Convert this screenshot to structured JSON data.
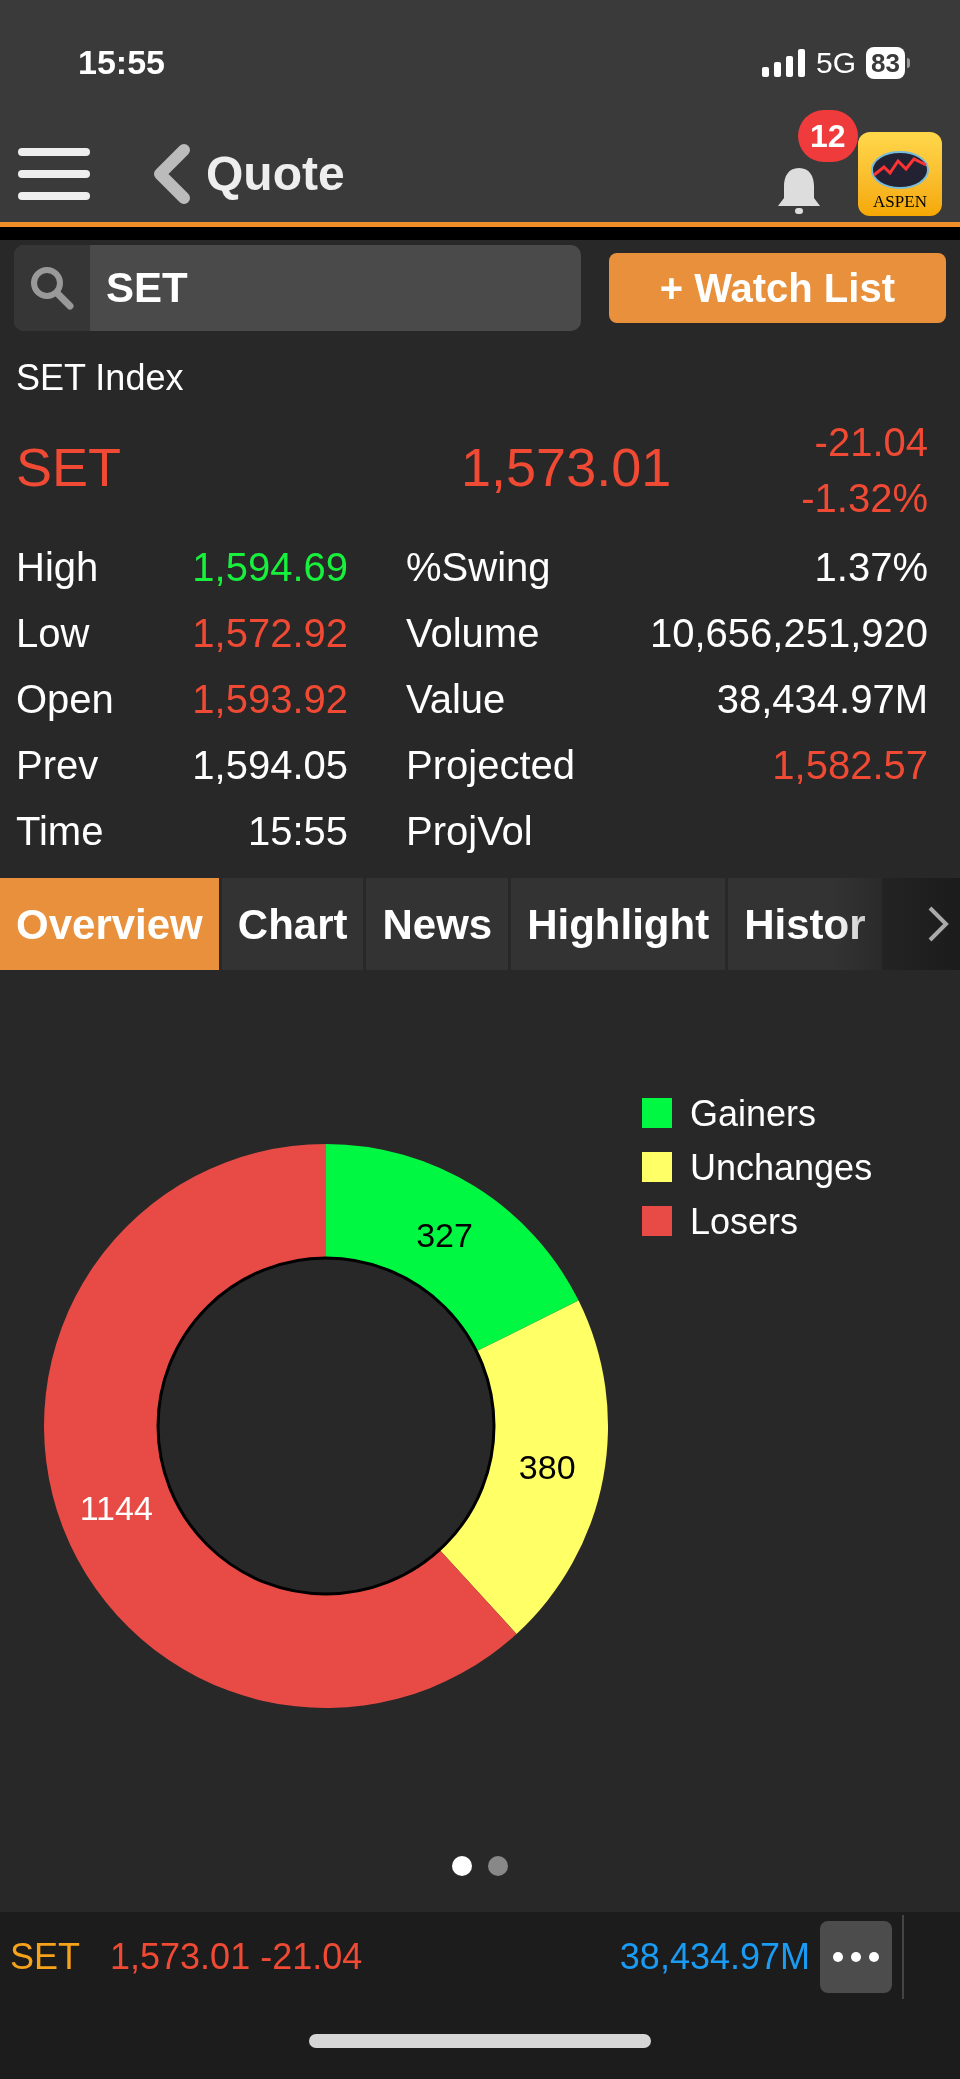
{
  "status_bar": {
    "time": "15:55",
    "network": "5G",
    "battery": "83"
  },
  "header": {
    "title": "Quote",
    "notification_count": "12",
    "logo_text": "ASPEN"
  },
  "search": {
    "value": "SET"
  },
  "watch_button": "+ Watch List",
  "index_name": "SET Index",
  "quote": {
    "symbol": "SET",
    "price": "1,573.01",
    "change": "-21.04",
    "change_pct": "-1.32%",
    "color": "#f04a34"
  },
  "stats_left": [
    {
      "label": "High",
      "value": "1,594.69",
      "color": "#17f03c"
    },
    {
      "label": "Low",
      "value": "1,572.92",
      "color": "#f04a34"
    },
    {
      "label": "Open",
      "value": "1,593.92",
      "color": "#f04a34"
    },
    {
      "label": "Prev",
      "value": "1,594.05",
      "color": "#ffffff"
    },
    {
      "label": "Time",
      "value": "15:55",
      "color": "#ffffff"
    }
  ],
  "stats_right": [
    {
      "label": "%Swing",
      "value": "1.37%",
      "color": "#ffffff"
    },
    {
      "label": "Volume",
      "value": "10,656,251,920",
      "color": "#ffffff"
    },
    {
      "label": "Value",
      "value": "38,434.97M",
      "color": "#ffffff"
    },
    {
      "label": "Projected",
      "value": "1,582.57",
      "color": "#f04a34"
    },
    {
      "label": "ProjVol"
    }
  ],
  "tabs": [
    {
      "label": "Overview",
      "selected": true
    },
    {
      "label": "Chart",
      "selected": false
    },
    {
      "label": "News",
      "selected": false
    },
    {
      "label": "Highlight",
      "selected": false
    },
    {
      "label": "Histor",
      "selected": false
    }
  ],
  "legend": [
    {
      "color": "#00f843"
    },
    {
      "color": "#ffff66"
    },
    {
      "color": "#e84b45"
    }
  ],
  "chart_data": {
    "type": "donut",
    "categories": [
      "Gainers",
      "Unchanges",
      "Losers"
    ],
    "values": [
      327,
      380,
      1144
    ],
    "data_labels": true,
    "legend": "right"
  },
  "pages": [
    {
      "selected": true
    },
    {
      "selected": false
    }
  ],
  "ticker": {
    "symbol": "SET",
    "price": "1,573.01",
    "change": "-21.04",
    "value": "38,434.97M"
  }
}
